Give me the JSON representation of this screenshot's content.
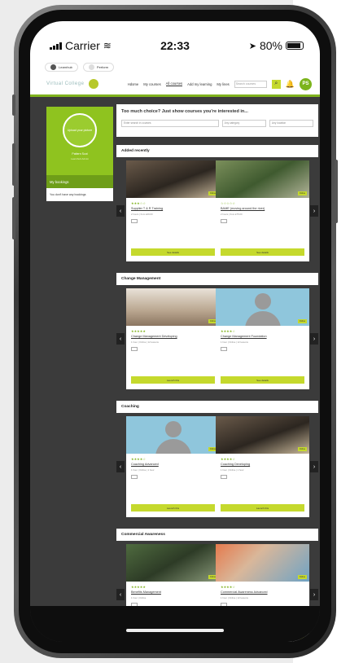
{
  "status": {
    "carrier": "Carrier",
    "time": "22:33",
    "battery": "80%"
  },
  "apptop": {
    "left_label": "Learnhub",
    "right_label": "Perform"
  },
  "nav": {
    "logo": "Virtual College",
    "links": [
      "Hdome",
      "My courses",
      "All courses",
      "Add my learning",
      "My lines"
    ],
    "search_placeholder": "Search courses",
    "avatar": "PS"
  },
  "sidebar": {
    "upload": "Upload your picture",
    "name": "Pattern Scot",
    "subtitle": "Learnhub Admin",
    "bookings_heading": "My bookings",
    "bookings_empty": "You don't have any bookings"
  },
  "choice": {
    "heading": "Too much choice? Just show courses you're interested in...",
    "filter1": "Enter search in courses",
    "filter2": "Any category",
    "filter3": "Any location"
  },
  "sections": [
    {
      "title": "Added recently",
      "cards": [
        {
          "title": "Supplier T & R Training",
          "stars": "★★★☆☆",
          "meta": "2 hours | from £49.00",
          "badge": "Online",
          "button": "See details"
        },
        {
          "title": "BAME (moving around the river)",
          "stars": "☆☆☆☆☆",
          "meta": "2 hours | from £75.00",
          "badge": "Online",
          "button": "See details"
        }
      ]
    },
    {
      "title": "Change Management",
      "cards": [
        {
          "title": "Change Management Developing",
          "stars": "★★★★★",
          "meta": "1 hour | Online | 12 lessons",
          "badge": "Online",
          "button": "Launch this"
        },
        {
          "title": "Change Management Foundation",
          "stars": "★★★★☆",
          "meta": "1 hour | Online | 12 lessons",
          "badge": "Online",
          "button": "See details"
        }
      ]
    },
    {
      "title": "Coaching",
      "cards": [
        {
          "title": "Coaching Advanced",
          "stars": "★★★★☆",
          "meta": "1 hour | Online | 1 hour",
          "badge": "Online",
          "button": "Launch this"
        },
        {
          "title": "Coaching Developing",
          "stars": "★★★★☆",
          "meta": "1 hour | Online | 1 hour",
          "badge": "Online",
          "button": "Launch this"
        }
      ]
    },
    {
      "title": "Commercial Awareness",
      "cards": [
        {
          "title": "Benefits Management",
          "stars": "★★★★★",
          "meta": "1 hour | Online",
          "badge": "Online",
          "button": "Launch this"
        },
        {
          "title": "Commercial Awareness Advanced",
          "stars": "★★★★☆",
          "meta": "1 hour | Online | 12 lessons",
          "badge": "Online",
          "button": "Launch this"
        }
      ]
    }
  ]
}
